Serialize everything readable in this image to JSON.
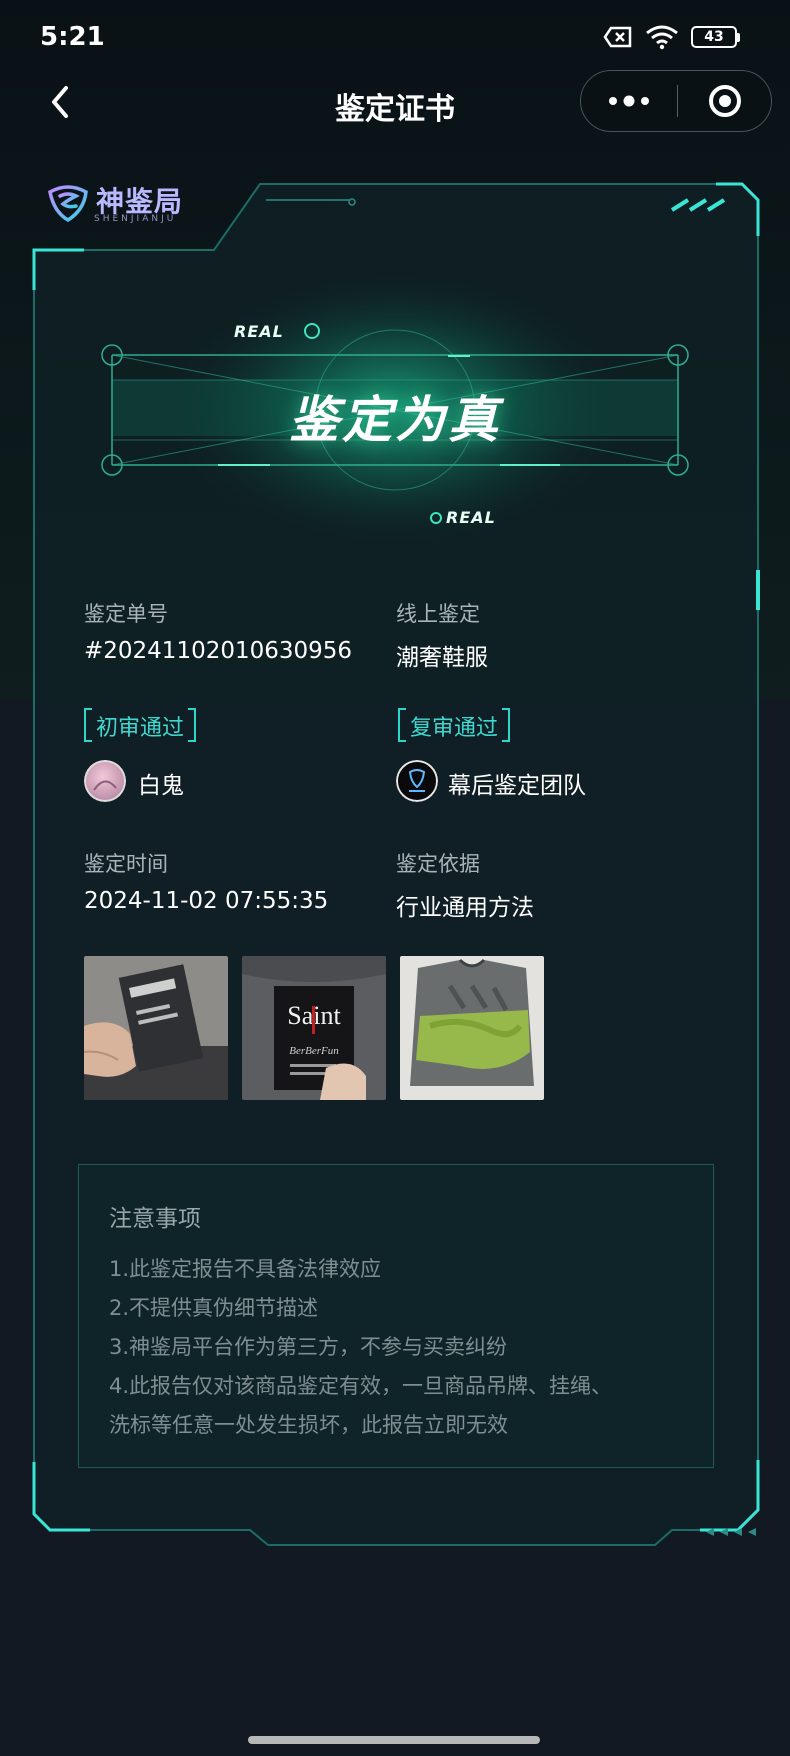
{
  "status_bar": {
    "time": "5:21",
    "battery": "43"
  },
  "nav": {
    "title": "鉴定证书"
  },
  "logo": {
    "cn": "神鉴局",
    "en": "SHENJIANJU"
  },
  "hero": {
    "real_top": "REAL",
    "real_bottom": "REAL",
    "title": "鉴定为真"
  },
  "info": {
    "order_label": "鉴定单号",
    "order_value": "#20241102010630956",
    "type_label": "线上鉴定",
    "type_value": "潮奢鞋服",
    "first_review_tag": "初审通过",
    "first_reviewer": "白鬼",
    "second_review_tag": "复审通过",
    "second_reviewer": "幕后鉴定团队",
    "time_label": "鉴定时间",
    "time_value": "2024-11-02 07:55:35",
    "basis_label": "鉴定依据",
    "basis_value": "行业通用方法"
  },
  "photos": {
    "tag_brand_text": "Saint",
    "tag_brand_sub": "BerBerFun"
  },
  "notes": {
    "title": "注意事项",
    "lines": [
      "1.此鉴定报告不具备法律效应",
      "2.不提供真伪细节描述",
      "3.神鉴局平台作为第三方，不参与买卖纠纷",
      "4.此报告仅对该商品鉴定有效，一旦商品吊牌、挂绳、",
      "洗标等任意一处发生损坏，此报告立即无效"
    ]
  },
  "colors": {
    "accent": "#2bd7c9",
    "background": "#131923",
    "hero_glow": "#3fe3bd"
  }
}
